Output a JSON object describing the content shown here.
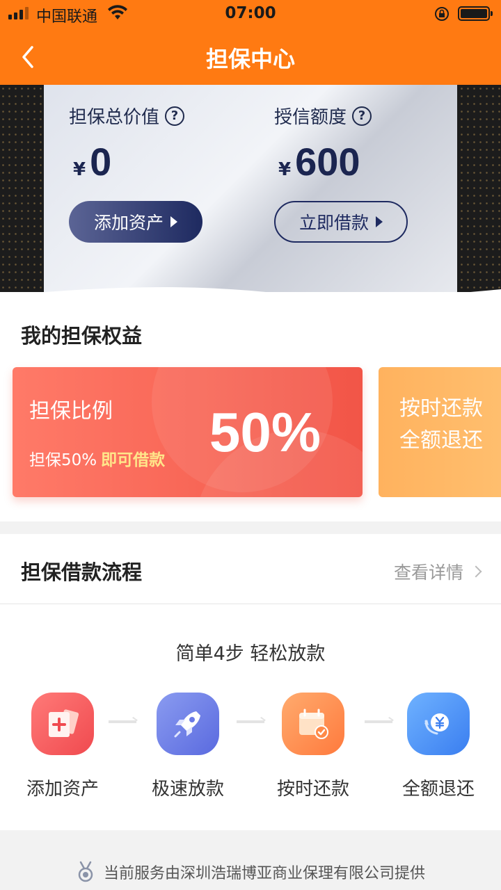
{
  "status_bar": {
    "carrier": "中国联通",
    "time": "07:00"
  },
  "nav": {
    "title": "担保中心"
  },
  "hero": {
    "total_value_label": "担保总价值",
    "total_value_currency": "¥",
    "total_value": "0",
    "credit_label": "授信额度",
    "credit_currency": "¥",
    "credit_value": "600",
    "add_asset_button": "添加资产",
    "borrow_button": "立即借款"
  },
  "benefits": {
    "section_title": "我的担保权益",
    "ratio_card": {
      "title": "担保比例",
      "desc": "担保50%",
      "desc_highlight": "即可借款",
      "value": "50%"
    },
    "refund_card": {
      "line1": "按时还款",
      "line2": "全额退还"
    }
  },
  "process": {
    "section_title": "担保借款流程",
    "details_link": "查看详情",
    "subtitle": "简单4步 轻松放款",
    "steps": [
      {
        "label": "添加资产",
        "icon": "add-card-icon"
      },
      {
        "label": "极速放款",
        "icon": "rocket-icon"
      },
      {
        "label": "按时还款",
        "icon": "calendar-check-icon"
      },
      {
        "label": "全额退还",
        "icon": "yuan-refund-icon"
      }
    ]
  },
  "footer": {
    "text": "当前服务由深圳浩瑞博亚商业保理有限公司提供",
    "icon": "medal-icon"
  },
  "colors": {
    "brand": "#ff7a12",
    "navy": "#1e2a60",
    "red_card": "#f25547",
    "orange_card": "#ffb25e"
  }
}
